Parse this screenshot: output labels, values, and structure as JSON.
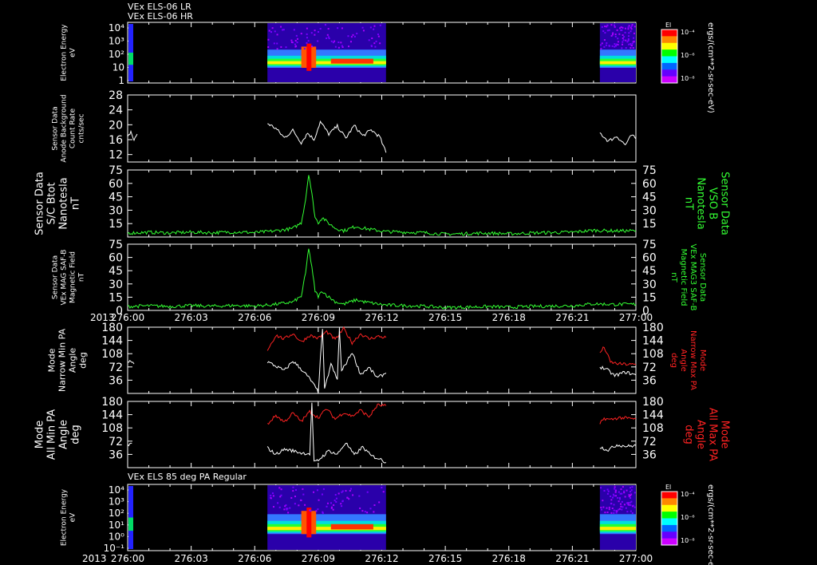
{
  "header": {
    "line1": "VEx ELS-06 LR",
    "line2": "VEx ELS-06 HR",
    "panel7_title": "VEx ELS 85 deg PA Regular"
  },
  "time_axis": {
    "year": "2013",
    "ticks": [
      "276:00",
      "276:03",
      "276:06",
      "276:09",
      "276:12",
      "276:15",
      "276:18",
      "276:21",
      "277:00"
    ]
  },
  "chart_data": [
    {
      "type": "heatmap",
      "id": "p1",
      "ylabel": [
        "Electron Energy",
        "eV"
      ],
      "y_ticks": [
        "10⁴",
        "10³",
        "10²",
        "10",
        "1"
      ],
      "colorbar": {
        "title": "El",
        "ticks": [
          "10⁻⁴",
          "10⁻⁶",
          "10⁻⁸"
        ],
        "unit": "ergs/(cm**2-sr-sec-eV)",
        "colors": [
          "#ff0000",
          "#ff8800",
          "#ffff00",
          "#00ff00",
          "#00ffff",
          "#0066ff",
          "#6600ff",
          "#cc00ff"
        ]
      },
      "data_intervals": [
        [
          6.6,
          12.2
        ],
        [
          22.3,
          24.0
        ]
      ]
    },
    {
      "type": "line",
      "id": "p2",
      "ylabel": [
        "Sensor Data",
        "Anode Background",
        "Count Rate",
        "cnts/sec"
      ],
      "ylim": [
        10,
        28
      ],
      "y_ticks": [
        12,
        16,
        20,
        24,
        28
      ],
      "series": [
        {
          "color": "#ffffff",
          "segments": [
            [
              [
                0.0,
                16.5
              ],
              [
                0.15,
                18.2
              ],
              [
                0.3,
                15.8
              ],
              [
                0.45,
                17.5
              ]
            ],
            [
              [
                6.6,
                20.4
              ],
              [
                7.0,
                19.0
              ],
              [
                7.4,
                16.5
              ],
              [
                7.8,
                18.5
              ],
              [
                8.2,
                15.2
              ],
              [
                8.5,
                17.8
              ],
              [
                8.8,
                16.0
              ],
              [
                9.1,
                20.8
              ],
              [
                9.5,
                17.5
              ],
              [
                9.9,
                19.6
              ],
              [
                10.3,
                16.4
              ],
              [
                10.7,
                19.8
              ],
              [
                11.1,
                17.0
              ],
              [
                11.5,
                18.6
              ],
              [
                11.9,
                16.8
              ],
              [
                12.2,
                12.5
              ]
            ],
            [
              [
                22.3,
                17.8
              ],
              [
                22.7,
                15.6
              ],
              [
                23.1,
                16.9
              ],
              [
                23.5,
                14.6
              ],
              [
                23.8,
                17.2
              ],
              [
                24.0,
                16.2
              ]
            ]
          ]
        }
      ]
    },
    {
      "type": "line",
      "id": "p3",
      "ylabel": [
        "Sensor Data",
        "S/C Btot",
        "Nanotesla",
        "nT"
      ],
      "ylabel_right": [
        "Sensor Data",
        "VSO B",
        "Nanotesla",
        "nT"
      ],
      "ylim": [
        0,
        75
      ],
      "y_ticks": [
        15,
        30,
        45,
        60,
        75
      ],
      "series": [
        {
          "color": "#33ff33",
          "segments": [
            [
              [
                0,
                4.5
              ],
              [
                1,
                5.2
              ],
              [
                2,
                4.6
              ],
              [
                3,
                5.4
              ],
              [
                4,
                4.8
              ],
              [
                5,
                5.6
              ],
              [
                6,
                5.0
              ],
              [
                6.6,
                6.0
              ],
              [
                7.2,
                7.5
              ],
              [
                7.8,
                9.5
              ],
              [
                8.2,
                16
              ],
              [
                8.4,
                42
              ],
              [
                8.55,
                71
              ],
              [
                8.7,
                48
              ],
              [
                8.85,
                22
              ],
              [
                9.0,
                16
              ],
              [
                9.2,
                22
              ],
              [
                9.4,
                17
              ],
              [
                9.8,
                10
              ],
              [
                10.2,
                7
              ],
              [
                10.8,
                12
              ],
              [
                11.1,
                10
              ],
              [
                11.6,
                8
              ],
              [
                12.2,
                6
              ],
              [
                13,
                5.5
              ],
              [
                14,
                4.8
              ],
              [
                15,
                3.2
              ],
              [
                16,
                3.8
              ],
              [
                17,
                4.4
              ],
              [
                18,
                3.6
              ],
              [
                19,
                4.5
              ],
              [
                20,
                5.0
              ],
              [
                21,
                5.3
              ],
              [
                22,
                7.5
              ],
              [
                23,
                6.8
              ],
              [
                24,
                7.0
              ]
            ]
          ]
        }
      ]
    },
    {
      "type": "line",
      "id": "p4",
      "ylabel": [
        "Sensor Data",
        "VEx MAG SAF-B",
        "Magnetic Field",
        "nT"
      ],
      "ylabel_right": [
        "Sensor Data",
        "VEx MAG3 SAF-B",
        "Magnetic Field",
        "nT"
      ],
      "ylim": [
        0,
        75
      ],
      "y_ticks": [
        0,
        15,
        30,
        45,
        60,
        75
      ],
      "series": [
        {
          "color": "#33ff33",
          "segments": [
            [
              [
                0,
                4.5
              ],
              [
                1,
                5.2
              ],
              [
                2,
                4.6
              ],
              [
                3,
                5.4
              ],
              [
                4,
                4.8
              ],
              [
                5,
                5.6
              ],
              [
                6,
                5.0
              ],
              [
                6.6,
                6.0
              ],
              [
                7.2,
                7.5
              ],
              [
                7.8,
                9.5
              ],
              [
                8.2,
                16
              ],
              [
                8.4,
                42
              ],
              [
                8.55,
                71
              ],
              [
                8.7,
                48
              ],
              [
                8.85,
                22
              ],
              [
                9.0,
                16
              ],
              [
                9.2,
                22
              ],
              [
                9.4,
                17
              ],
              [
                9.8,
                10
              ],
              [
                10.2,
                7
              ],
              [
                10.8,
                12
              ],
              [
                11.1,
                10
              ],
              [
                11.6,
                8
              ],
              [
                12.2,
                6
              ],
              [
                13,
                5.5
              ],
              [
                14,
                4.8
              ],
              [
                15,
                3.2
              ],
              [
                16,
                3.8
              ],
              [
                17,
                4.4
              ],
              [
                18,
                3.6
              ],
              [
                19,
                4.5
              ],
              [
                20,
                5.0
              ],
              [
                21,
                5.3
              ],
              [
                22,
                7.5
              ],
              [
                23,
                6.8
              ],
              [
                24,
                7.0
              ]
            ]
          ]
        }
      ]
    },
    {
      "type": "line",
      "id": "p5",
      "ylabel": [
        "Mode",
        "Narrow Min PA",
        "Angle",
        "deg"
      ],
      "ylabel_right": [
        "Mode",
        "Narrow Max PA",
        "Angle",
        "deg"
      ],
      "ylim": [
        0,
        180
      ],
      "y_ticks": [
        36,
        72,
        108,
        144,
        180
      ],
      "series": [
        {
          "color": "#ff2222",
          "segments": [
            [
              [
                6.6,
                118
              ],
              [
                7.0,
                158
              ],
              [
                7.4,
                148
              ],
              [
                7.8,
                163
              ],
              [
                8.2,
                140
              ],
              [
                8.6,
                158
              ],
              [
                9.0,
                150
              ],
              [
                9.4,
                168
              ],
              [
                9.8,
                146
              ],
              [
                10.2,
                176
              ],
              [
                10.6,
                138
              ],
              [
                11.0,
                162
              ],
              [
                11.4,
                148
              ],
              [
                11.8,
                155
              ],
              [
                12.2,
                152
              ]
            ],
            [
              [
                22.3,
                110
              ],
              [
                22.5,
                126
              ],
              [
                22.8,
                85
              ],
              [
                23.2,
                80
              ],
              [
                24.0,
                78
              ]
            ]
          ]
        },
        {
          "color": "#ffffff",
          "segments": [
            [
              [
                0.0,
                84
              ],
              [
                0.15,
                90
              ],
              [
                0.3,
                80
              ]
            ],
            [
              [
                6.6,
                86
              ],
              [
                7.0,
                74
              ],
              [
                7.4,
                62
              ],
              [
                7.8,
                88
              ],
              [
                8.2,
                66
              ],
              [
                8.6,
                40
              ],
              [
                9.0,
                4
              ],
              [
                9.2,
                178
              ],
              [
                9.3,
                10
              ],
              [
                9.6,
                80
              ],
              [
                9.9,
                36
              ],
              [
                10.0,
                178
              ],
              [
                10.1,
                60
              ],
              [
                10.6,
                112
              ],
              [
                11.0,
                52
              ],
              [
                11.4,
                70
              ],
              [
                11.8,
                42
              ],
              [
                12.2,
                56
              ]
            ],
            [
              [
                22.3,
                72
              ],
              [
                22.6,
                66
              ],
              [
                23.0,
                48
              ],
              [
                23.5,
                58
              ],
              [
                24.0,
                50
              ]
            ]
          ]
        }
      ]
    },
    {
      "type": "line",
      "id": "p6",
      "ylabel": [
        "Mode",
        "All Min PA",
        "Angle",
        "deg"
      ],
      "ylabel_right": [
        "Mode",
        "All Max PA",
        "Angle",
        "deg"
      ],
      "ylim": [
        0,
        180
      ],
      "y_ticks": [
        36,
        72,
        108,
        144,
        180
      ],
      "series": [
        {
          "color": "#ff2222",
          "segments": [
            [
              [
                6.6,
                118
              ],
              [
                7.0,
                142
              ],
              [
                7.4,
                124
              ],
              [
                7.8,
                148
              ],
              [
                8.2,
                126
              ],
              [
                8.6,
                152
              ],
              [
                9.0,
                136
              ],
              [
                9.4,
                160
              ],
              [
                9.8,
                132
              ],
              [
                10.2,
                150
              ],
              [
                10.6,
                140
              ],
              [
                11.0,
                156
              ],
              [
                11.4,
                138
              ],
              [
                11.8,
                170
              ],
              [
                12.2,
                168
              ]
            ],
            [
              [
                22.3,
                118
              ],
              [
                22.5,
                134
              ],
              [
                22.8,
                130
              ],
              [
                23.2,
                136
              ],
              [
                24.0,
                132
              ]
            ]
          ]
        },
        {
          "color": "#ffffff",
          "segments": [
            [
              [
                0.0,
                60
              ],
              [
                0.2,
                66
              ]
            ],
            [
              [
                6.6,
                54
              ],
              [
                7.0,
                36
              ],
              [
                7.4,
                50
              ],
              [
                7.8,
                46
              ],
              [
                8.2,
                40
              ],
              [
                8.6,
                38
              ],
              [
                8.7,
                178
              ],
              [
                8.8,
                14
              ],
              [
                9.0,
                20
              ],
              [
                9.5,
                46
              ],
              [
                9.9,
                36
              ],
              [
                10.3,
                68
              ],
              [
                10.7,
                34
              ],
              [
                11.1,
                56
              ],
              [
                11.5,
                32
              ],
              [
                11.9,
                24
              ],
              [
                12.2,
                14
              ]
            ],
            [
              [
                22.3,
                56
              ],
              [
                22.7,
                48
              ],
              [
                23.1,
                62
              ],
              [
                23.6,
                58
              ],
              [
                24.0,
                60
              ]
            ]
          ]
        }
      ]
    },
    {
      "type": "heatmap",
      "id": "p7",
      "ylabel": [
        "Electron Energy",
        "eV"
      ],
      "y_ticks": [
        "10⁴",
        "10³",
        "10²",
        "10¹",
        "10⁰",
        "10⁻¹"
      ],
      "colorbar": {
        "title": "El",
        "ticks": [
          "10⁻⁴",
          "10⁻⁶",
          "10⁻⁸"
        ],
        "unit": "ergs/(cm**2-sr-sec-eV)",
        "colors": [
          "#ff0000",
          "#ff8800",
          "#ffff00",
          "#00ff00",
          "#00ffff",
          "#0066ff",
          "#6600ff",
          "#cc00ff"
        ]
      },
      "data_intervals": [
        [
          6.6,
          12.2
        ],
        [
          22.3,
          24.0
        ]
      ]
    }
  ]
}
